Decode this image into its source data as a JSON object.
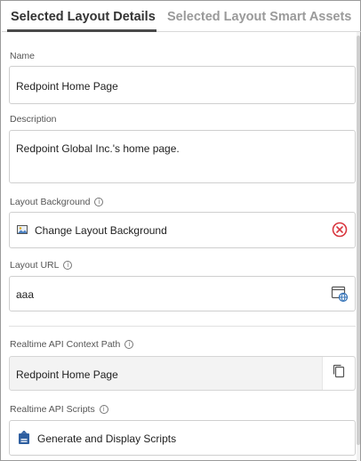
{
  "tabs": {
    "active": "Selected Layout Details",
    "inactive": "Selected Layout Smart Assets"
  },
  "name": {
    "label": "Name",
    "value": "Redpoint Home Page"
  },
  "description": {
    "label": "Description",
    "value": "Redpoint Global Inc.'s home page."
  },
  "layout_background": {
    "label": "Layout Background",
    "button_label": "Change Layout Background"
  },
  "layout_url": {
    "label": "Layout URL",
    "value": "aaa"
  },
  "api_context_path": {
    "label": "Realtime API Context Path",
    "value": "Redpoint Home Page"
  },
  "api_scripts": {
    "label": "Realtime API Scripts",
    "button_label": "Generate and Display Scripts"
  },
  "colors": {
    "clear_red": "#d9363e",
    "url_blue": "#2f6fb5"
  },
  "icons": {
    "info": "info-icon",
    "image": "image-icon",
    "clear": "clear-circle-x-icon",
    "url": "browser-globe-icon",
    "copy": "copy-icon",
    "script": "script-export-icon"
  }
}
